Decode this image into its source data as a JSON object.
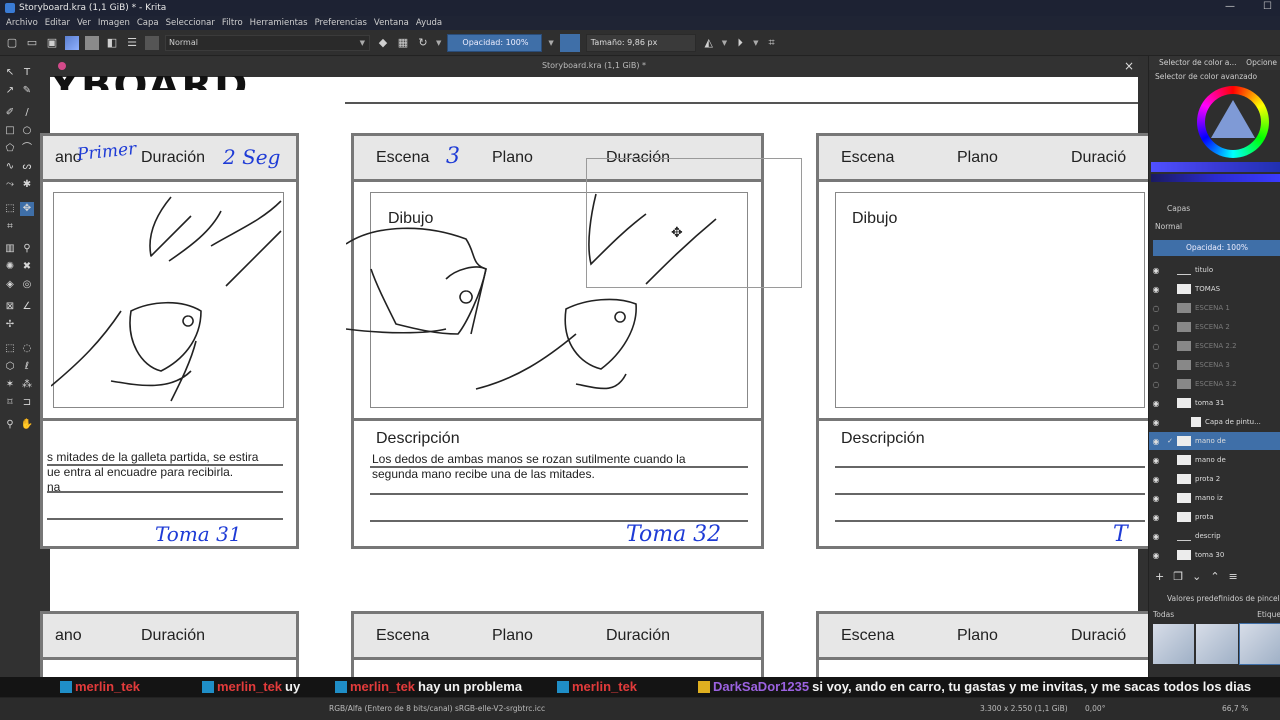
{
  "window": {
    "title": "Storyboard.kra (1,1 GiB) * - Krita",
    "minimize": "—",
    "maximize": "☐"
  },
  "menu": [
    "Archivo",
    "Editar",
    "Ver",
    "Imagen",
    "Capa",
    "Seleccionar",
    "Filtro",
    "Herramientas",
    "Preferencias",
    "Ventana",
    "Ayuda"
  ],
  "toolbar": {
    "blend_mode": "Normal",
    "opacity": "Opacidad: 100%",
    "size": "Tamaño: 9,86 px"
  },
  "document": {
    "tab_title": "Storyboard.kra (1,1 GiB) *",
    "close": "×",
    "heading_fragment": "YBOARD"
  },
  "panels": {
    "p1": {
      "header": [
        "ano",
        "Duración"
      ],
      "hand_plano": "Primer",
      "hand_duracion": "2 Seg",
      "desc_text": [
        "s mitades de la galleta partida, se estira",
        "ue entra al encuadre para recibirla.",
        "na"
      ],
      "toma": "Toma 31"
    },
    "p2": {
      "header": [
        "Escena",
        "Plano",
        "Duración"
      ],
      "hand_escena": "3",
      "drawing_label": "Dibujo",
      "desc_label": "Descripción",
      "desc_text": [
        "Los dedos de ambas manos se rozan sutilmente cuando la",
        "segunda mano recibe una de las mitades."
      ],
      "toma": "Toma 32"
    },
    "p3": {
      "header": [
        "Escena",
        "Plano",
        "Duració"
      ],
      "drawing_label": "Dibujo",
      "desc_label": "Descripción",
      "toma": "T"
    },
    "p4": {
      "header": [
        "ano",
        "Duración"
      ]
    },
    "p5": {
      "header": [
        "Escena",
        "Plano",
        "Duración"
      ]
    },
    "p6": {
      "header": [
        "Escena",
        "Plano",
        "Duració"
      ]
    }
  },
  "right_panel": {
    "tabs": [
      "Selector de color a...",
      "Opcione"
    ],
    "color_selector_title": "Selector de color avanzado",
    "layers_title": "Capas",
    "blend_mode": "Normal",
    "opacity": "Opacidad:  100%",
    "layers": [
      {
        "name": "titulo",
        "visible": true,
        "state": "normal"
      },
      {
        "name": "TOMAS",
        "visible": true,
        "state": "normal"
      },
      {
        "name": "ESCENA 1",
        "visible": false,
        "state": "hidden"
      },
      {
        "name": "ESCENA 2",
        "visible": false,
        "state": "hidden"
      },
      {
        "name": "ESCENA 2.2",
        "visible": false,
        "state": "hidden"
      },
      {
        "name": "ESCENA 3",
        "visible": false,
        "state": "hidden"
      },
      {
        "name": "ESCENA 3.2",
        "visible": false,
        "state": "hidden"
      },
      {
        "name": "toma 31",
        "visible": true,
        "state": "normal"
      },
      {
        "name": "Capa de pintu...",
        "visible": true,
        "state": "normal"
      },
      {
        "name": "mano de",
        "visible": true,
        "state": "active"
      },
      {
        "name": "mano de",
        "visible": true,
        "state": "normal"
      },
      {
        "name": "prota 2",
        "visible": true,
        "state": "normal"
      },
      {
        "name": "mano iz",
        "visible": true,
        "state": "normal"
      },
      {
        "name": "prota",
        "visible": true,
        "state": "normal"
      },
      {
        "name": "descrip",
        "visible": true,
        "state": "normal"
      },
      {
        "name": "toma 30",
        "visible": true,
        "state": "normal"
      }
    ],
    "brush_title": "Valores predefinidos de pincel",
    "brush_filter": "Todas",
    "brush_tag": "Etique"
  },
  "chat": [
    {
      "user": "merlin_tek",
      "message": ""
    },
    {
      "user": "merlin_tek",
      "message": "uy"
    },
    {
      "user": "merlin_tek",
      "message": "hay un problema"
    },
    {
      "user": "merlin_tek",
      "message": ""
    },
    {
      "user": "DarkSaDor1235",
      "message": "si voy, ando en carro, tu gastas y me invitas, y me sacas todos los dias"
    }
  ],
  "status": {
    "color_space": "RGB/Alfa (Entero de 8 bits/canal)  sRGB-elle-V2-srgbtrc.icc",
    "dimensions": "3.300 x 2.550 (1,1 GiB)",
    "rotation": "0,00°",
    "zoom": "66,7 %"
  },
  "colors": {
    "accent": "#3f6fa8",
    "handwriting": "#1e3bd6",
    "chat_user": "#e23b3b",
    "chat_user2": "#9b62e0"
  }
}
